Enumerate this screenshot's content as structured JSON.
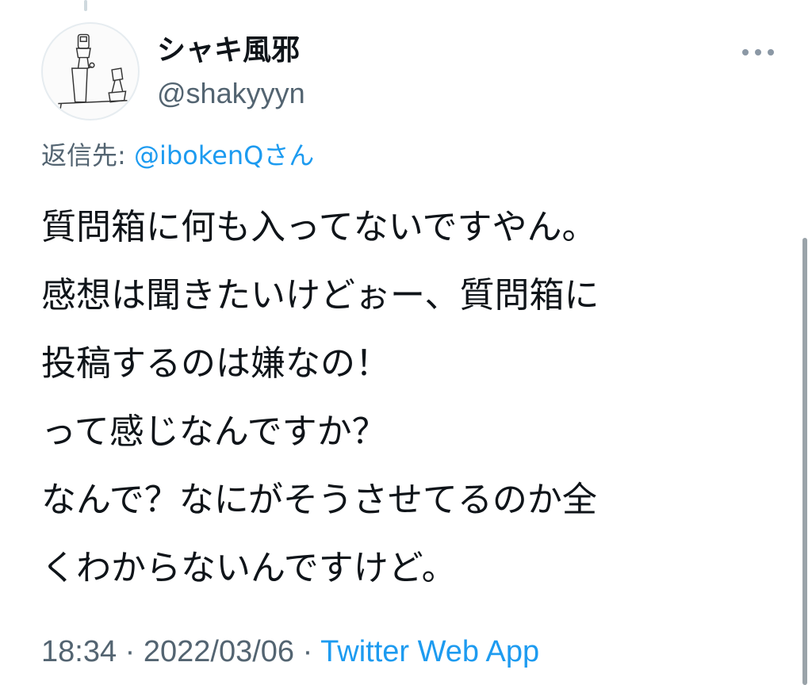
{
  "author": {
    "display_name": "シャキ風邪",
    "handle": "@shakyyyn"
  },
  "reply": {
    "prefix": "返信先:",
    "mention": "@ibokenQ",
    "suffix": "さん"
  },
  "tweet": {
    "lines": [
      "質問箱に何も入ってないですやん。",
      "感想は聞きたいけどぉー、質問箱に",
      "投稿するのは嫌なの！",
      "って感じなんですか？",
      "なんで？なにがそうさせてるのか全",
      "くわからないんですけど。"
    ]
  },
  "meta": {
    "time": "18:34",
    "separator": " · ",
    "date": "2022/03/06",
    "source": "Twitter Web App"
  },
  "icons": {
    "more": "more-horizontal-icon",
    "avatar": "avatar-drawing"
  },
  "colors": {
    "text": "#0f1419",
    "secondary": "#536471",
    "link": "#1d9bf0"
  }
}
